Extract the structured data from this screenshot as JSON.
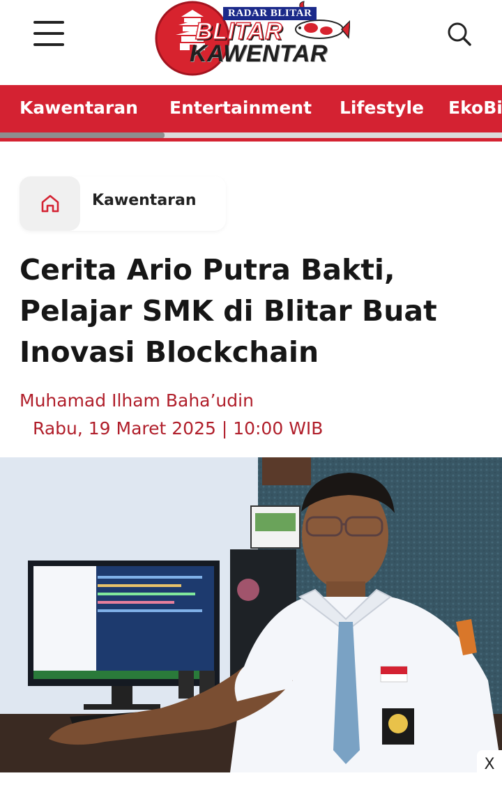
{
  "header": {
    "logo": {
      "badge": "RADAR BLITAR",
      "line1": "BLITAR",
      "line2": "KAWENTAR"
    },
    "menu_icon": "hamburger-menu-icon",
    "search_icon": "search-icon"
  },
  "category_nav": {
    "items": [
      "Kawentaran",
      "Entertainment",
      "Lifestyle",
      "EkoBis"
    ]
  },
  "breadcrumb": {
    "home_icon": "home-icon",
    "label": "Kawentaran"
  },
  "article": {
    "title": "Cerita Ario Putra Bakti, Pelajar SMK di Blitar Buat Inovasi Blockchain",
    "author": "Muhamad Ilham Baha’udin",
    "date": "Rabu, 19 Maret 2025 | 10:00 WIB"
  },
  "ad": {
    "close_label": "X"
  },
  "colors": {
    "brand_red": "#d42232",
    "meta_red": "#b01e2a",
    "text_dark": "#161616"
  }
}
